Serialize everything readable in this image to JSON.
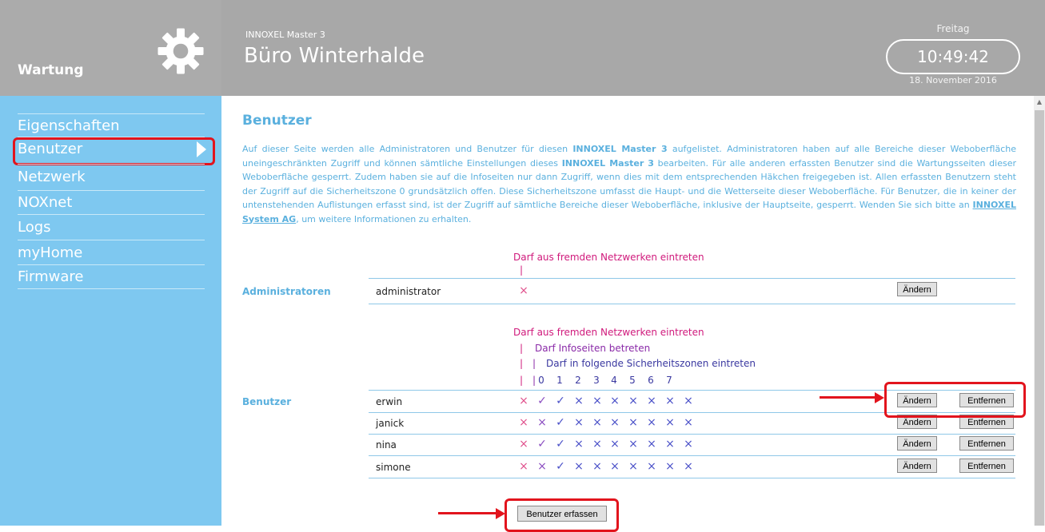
{
  "header": {
    "section_title": "Wartung",
    "device_name": "INNOXEL Master 3",
    "room_name": "Büro Winterhalde",
    "weekday": "Freitag",
    "time": "10:49:42",
    "date": "18. November 2016"
  },
  "sidebar": {
    "items": [
      {
        "label": "Eigenschaften"
      },
      {
        "label": "Benutzer"
      },
      {
        "label": "Netzwerk"
      },
      {
        "label": "NOXnet"
      },
      {
        "label": "Logs"
      },
      {
        "label": "myHome"
      },
      {
        "label": "Firmware"
      }
    ],
    "active": "Benutzer"
  },
  "main": {
    "title": "Benutzer",
    "intro": {
      "p1": "Auf dieser Seite werden alle Administratoren und Benutzer für diesen ",
      "b1": "INNOXEL Master 3",
      "p2": " aufgelistet. Administratoren haben auf alle Bereiche dieser Weboberfläche uneingeschränkten Zugriff und können sämtliche Einstellungen dieses ",
      "b2": "INNOXEL Master 3",
      "p3": " bearbeiten. Für alle anderen erfassten Benutzer sind die Wartungsseiten dieser Weboberfläche gesperrt. Zudem haben sie auf die Infoseiten nur dann Zugriff, wenn dies mit dem entsprechenden Häkchen freigegeben ist. Allen erfassten Benutzern steht der Zugriff auf die Sicherheitszone 0 grundsätzlich offen. Diese Sicherheitszone umfasst die Haupt- und die Wetterseite dieser Weboberfläche. Für Benutzer, die in keiner der untenstehenden Auflistungen erfasst sind, ist der Zugriff auf sämtliche Bereiche dieser Weboberfläche, inklusive der Hauptseite, gesperrt. Wenden Sie sich bitte an ",
      "link": "INNOXEL System AG",
      "p4": ", um weitere Informationen zu erhalten."
    },
    "admins": {
      "label": "Administratoren",
      "header_external": "Darf aus fremden Netzwerken eintreten",
      "header_bar": "|",
      "rows": [
        {
          "name": "administrator",
          "external": "×",
          "edit": "Ändern"
        }
      ]
    },
    "users": {
      "label": "Benutzer",
      "header_external": "Darf aus fremden Netzwerken eintreten",
      "header_info": "Darf Infoseiten betreten",
      "header_zones": "Darf in folgende Sicherheitszonen eintreten",
      "bar": "|",
      "zone_numbers": [
        "0",
        "1",
        "2",
        "3",
        "4",
        "5",
        "6",
        "7"
      ],
      "rows": [
        {
          "name": "erwin",
          "external": "×",
          "info": "✓",
          "zones": [
            "✓",
            "×",
            "×",
            "×",
            "×",
            "×",
            "×",
            "×"
          ],
          "edit": "Ändern",
          "remove": "Entfernen"
        },
        {
          "name": "janick",
          "external": "×",
          "info": "×",
          "zones": [
            "✓",
            "×",
            "×",
            "×",
            "×",
            "×",
            "×",
            "×"
          ],
          "edit": "Ändern",
          "remove": "Entfernen"
        },
        {
          "name": "nina",
          "external": "×",
          "info": "✓",
          "zones": [
            "✓",
            "×",
            "×",
            "×",
            "×",
            "×",
            "×",
            "×"
          ],
          "edit": "Ändern",
          "remove": "Entfernen"
        },
        {
          "name": "simone",
          "external": "×",
          "info": "×",
          "zones": [
            "✓",
            "×",
            "×",
            "×",
            "×",
            "×",
            "×",
            "×"
          ],
          "edit": "Ändern",
          "remove": "Entfernen"
        }
      ],
      "add_button": "Benutzer erfassen"
    }
  },
  "colors": {
    "sidebar_bg": "#7ec8f0",
    "header_bg": "#a8a8a8",
    "accent_blue": "#5ab0de",
    "highlight_red": "#e2141d",
    "external_pink": "#d01a7c",
    "info_purple": "#8a2aa8",
    "zones_blue": "#3a38a0"
  }
}
